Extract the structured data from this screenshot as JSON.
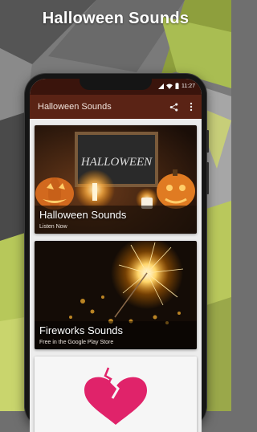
{
  "promo": {
    "title": "Halloween Sounds"
  },
  "status_bar": {
    "time": "11:27",
    "icons": [
      "signal-icon",
      "wifi-icon",
      "battery-icon"
    ]
  },
  "app_bar": {
    "title": "Halloween Sounds",
    "actions": [
      "share-icon",
      "more-vert-icon"
    ]
  },
  "cards": [
    {
      "title": "Halloween Sounds",
      "subtitle": "Listen Now",
      "board_text": "HALLOWEEN"
    },
    {
      "title": "Fireworks Sounds",
      "subtitle": "Free in the Google Play Store"
    },
    {
      "title": "",
      "subtitle": ""
    }
  ],
  "colors": {
    "status_bar": "#3a140c",
    "app_bar": "#5a2315",
    "background_green": "#b7c85a",
    "content_bg": "#ececec"
  }
}
